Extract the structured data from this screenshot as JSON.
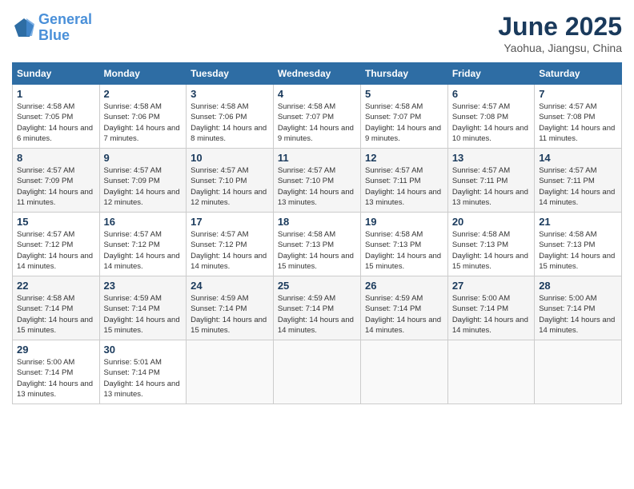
{
  "header": {
    "logo_line1": "General",
    "logo_line2": "Blue",
    "month_year": "June 2025",
    "location": "Yaohua, Jiangsu, China"
  },
  "weekdays": [
    "Sunday",
    "Monday",
    "Tuesday",
    "Wednesday",
    "Thursday",
    "Friday",
    "Saturday"
  ],
  "weeks": [
    [
      {
        "day": 1,
        "sunrise": "4:58 AM",
        "sunset": "7:05 PM",
        "daylight": "14 hours and 6 minutes."
      },
      {
        "day": 2,
        "sunrise": "4:58 AM",
        "sunset": "7:06 PM",
        "daylight": "14 hours and 7 minutes."
      },
      {
        "day": 3,
        "sunrise": "4:58 AM",
        "sunset": "7:06 PM",
        "daylight": "14 hours and 8 minutes."
      },
      {
        "day": 4,
        "sunrise": "4:58 AM",
        "sunset": "7:07 PM",
        "daylight": "14 hours and 9 minutes."
      },
      {
        "day": 5,
        "sunrise": "4:58 AM",
        "sunset": "7:07 PM",
        "daylight": "14 hours and 9 minutes."
      },
      {
        "day": 6,
        "sunrise": "4:57 AM",
        "sunset": "7:08 PM",
        "daylight": "14 hours and 10 minutes."
      },
      {
        "day": 7,
        "sunrise": "4:57 AM",
        "sunset": "7:08 PM",
        "daylight": "14 hours and 11 minutes."
      }
    ],
    [
      {
        "day": 8,
        "sunrise": "4:57 AM",
        "sunset": "7:09 PM",
        "daylight": "14 hours and 11 minutes."
      },
      {
        "day": 9,
        "sunrise": "4:57 AM",
        "sunset": "7:09 PM",
        "daylight": "14 hours and 12 minutes."
      },
      {
        "day": 10,
        "sunrise": "4:57 AM",
        "sunset": "7:10 PM",
        "daylight": "14 hours and 12 minutes."
      },
      {
        "day": 11,
        "sunrise": "4:57 AM",
        "sunset": "7:10 PM",
        "daylight": "14 hours and 13 minutes."
      },
      {
        "day": 12,
        "sunrise": "4:57 AM",
        "sunset": "7:11 PM",
        "daylight": "14 hours and 13 minutes."
      },
      {
        "day": 13,
        "sunrise": "4:57 AM",
        "sunset": "7:11 PM",
        "daylight": "14 hours and 13 minutes."
      },
      {
        "day": 14,
        "sunrise": "4:57 AM",
        "sunset": "7:11 PM",
        "daylight": "14 hours and 14 minutes."
      }
    ],
    [
      {
        "day": 15,
        "sunrise": "4:57 AM",
        "sunset": "7:12 PM",
        "daylight": "14 hours and 14 minutes."
      },
      {
        "day": 16,
        "sunrise": "4:57 AM",
        "sunset": "7:12 PM",
        "daylight": "14 hours and 14 minutes."
      },
      {
        "day": 17,
        "sunrise": "4:57 AM",
        "sunset": "7:12 PM",
        "daylight": "14 hours and 14 minutes."
      },
      {
        "day": 18,
        "sunrise": "4:58 AM",
        "sunset": "7:13 PM",
        "daylight": "14 hours and 15 minutes."
      },
      {
        "day": 19,
        "sunrise": "4:58 AM",
        "sunset": "7:13 PM",
        "daylight": "14 hours and 15 minutes."
      },
      {
        "day": 20,
        "sunrise": "4:58 AM",
        "sunset": "7:13 PM",
        "daylight": "14 hours and 15 minutes."
      },
      {
        "day": 21,
        "sunrise": "4:58 AM",
        "sunset": "7:13 PM",
        "daylight": "14 hours and 15 minutes."
      }
    ],
    [
      {
        "day": 22,
        "sunrise": "4:58 AM",
        "sunset": "7:14 PM",
        "daylight": "14 hours and 15 minutes."
      },
      {
        "day": 23,
        "sunrise": "4:59 AM",
        "sunset": "7:14 PM",
        "daylight": "14 hours and 15 minutes."
      },
      {
        "day": 24,
        "sunrise": "4:59 AM",
        "sunset": "7:14 PM",
        "daylight": "14 hours and 15 minutes."
      },
      {
        "day": 25,
        "sunrise": "4:59 AM",
        "sunset": "7:14 PM",
        "daylight": "14 hours and 14 minutes."
      },
      {
        "day": 26,
        "sunrise": "4:59 AM",
        "sunset": "7:14 PM",
        "daylight": "14 hours and 14 minutes."
      },
      {
        "day": 27,
        "sunrise": "5:00 AM",
        "sunset": "7:14 PM",
        "daylight": "14 hours and 14 minutes."
      },
      {
        "day": 28,
        "sunrise": "5:00 AM",
        "sunset": "7:14 PM",
        "daylight": "14 hours and 14 minutes."
      }
    ],
    [
      {
        "day": 29,
        "sunrise": "5:00 AM",
        "sunset": "7:14 PM",
        "daylight": "14 hours and 13 minutes."
      },
      {
        "day": 30,
        "sunrise": "5:01 AM",
        "sunset": "7:14 PM",
        "daylight": "14 hours and 13 minutes."
      },
      null,
      null,
      null,
      null,
      null
    ]
  ]
}
